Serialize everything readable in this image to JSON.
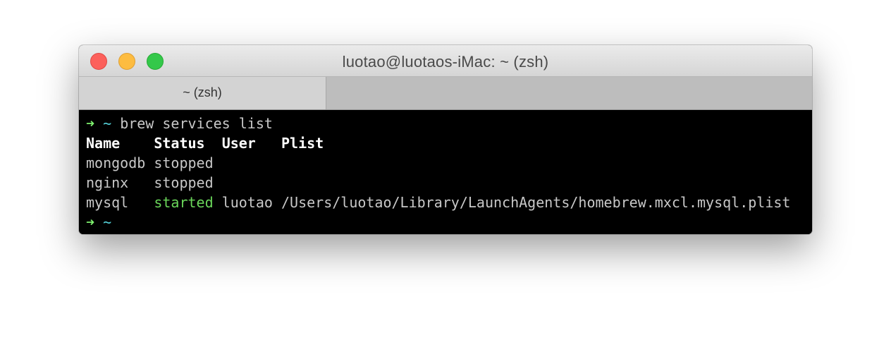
{
  "window": {
    "title": "luotao@luotaos-iMac: ~ (zsh)"
  },
  "tabs": [
    {
      "label": "~ (zsh)",
      "active": true
    }
  ],
  "terminal": {
    "prompt_arrow": "➜",
    "prompt_dir": "~",
    "command": "brew services list",
    "header": [
      "Name",
      "Status",
      "User",
      "Plist"
    ],
    "rows": [
      {
        "name": "mongodb",
        "status": "stopped",
        "user": "",
        "plist": ""
      },
      {
        "name": "nginx",
        "status": "stopped",
        "user": "",
        "plist": ""
      },
      {
        "name": "mysql",
        "status": "started",
        "user": "luotao",
        "plist": "/Users/luotao/Library/LaunchAgents/homebrew.mxcl.mysql.plist"
      }
    ]
  },
  "colors": {
    "close": "#fc605b",
    "minimize": "#fdbc40",
    "zoom": "#34c84a",
    "prompt_arrow": "#7ef06e",
    "prompt_dir": "#56d5dc",
    "started_status": "#6ad65a",
    "terminal_bg": "#000000"
  }
}
